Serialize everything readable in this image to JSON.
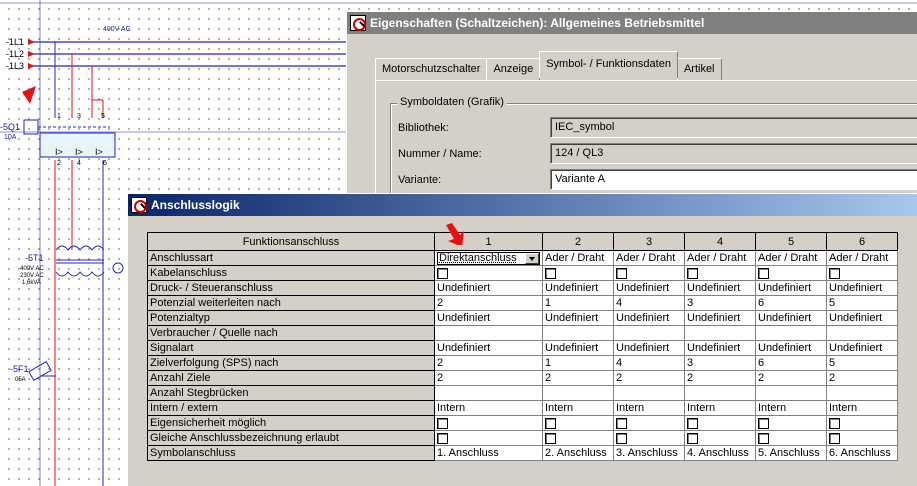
{
  "schematic": {
    "phases": [
      "-1L1",
      "-1L2",
      "-1L3"
    ],
    "voltage_label": "400V AC",
    "breaker_tag": "-5Q1",
    "breaker_rating": "10A",
    "transformer_tag": "-5T1",
    "transformer_specs": [
      "400V AC",
      "230V AC",
      "1,6kVA"
    ],
    "fuse_tag": "-5F1",
    "fuse_rating": "05A",
    "terminal_numbers": [
      "1",
      "3",
      "5",
      "2",
      "4",
      "6"
    ],
    "trip_symbol": "I>",
    "annotation_color": "#e81010"
  },
  "properties_dialog": {
    "title": "Eigenschaften (Schaltzeichen): Allgemeines Betriebsmittel",
    "tabs": [
      "Motorschutzschalter",
      "Anzeige",
      "Symbol- / Funktionsdaten",
      "Artikel"
    ],
    "selected_tab": "Symbol- / Funktionsdaten",
    "group_title": "Symboldaten (Grafik)",
    "fields": {
      "library_label": "Bibliothek:",
      "library_value": "IEC_symbol",
      "number_label": "Nummer / Name:",
      "number_value": "124 / QL3",
      "variant_label": "Variante:",
      "variant_value": "Variante A"
    }
  },
  "logic_dialog": {
    "title": "Anschlusslogik",
    "corner_header": "Funktionsanschluss",
    "columns": [
      "1",
      "2",
      "3",
      "4",
      "5",
      "6"
    ],
    "rows": [
      {
        "label": "Anschlussart",
        "type": "text",
        "values": [
          "Direktanschluss",
          "Ader / Draht",
          "Ader / Draht",
          "Ader / Draht",
          "Ader / Draht",
          "Ader / Draht"
        ]
      },
      {
        "label": "Kabelanschluss",
        "type": "checkbox",
        "values": [
          "",
          "",
          "",
          "",
          "",
          ""
        ]
      },
      {
        "label": "Druck- / Steueranschluss",
        "type": "text",
        "values": [
          "Undefiniert",
          "Undefiniert",
          "Undefiniert",
          "Undefiniert",
          "Undefiniert",
          "Undefiniert"
        ]
      },
      {
        "label": "Potenzial weiterleiten nach",
        "type": "text",
        "values": [
          "2",
          "1",
          "4",
          "3",
          "6",
          "5"
        ]
      },
      {
        "label": "Potenzialtyp",
        "type": "text",
        "values": [
          "Undefiniert",
          "Undefiniert",
          "Undefiniert",
          "Undefiniert",
          "Undefiniert",
          "Undefiniert"
        ]
      },
      {
        "label": "Verbraucher / Quelle nach",
        "type": "text",
        "values": [
          "",
          "",
          "",
          "",
          "",
          ""
        ]
      },
      {
        "label": "Signalart",
        "type": "text",
        "values": [
          "Undefiniert",
          "Undefiniert",
          "Undefiniert",
          "Undefiniert",
          "Undefiniert",
          "Undefiniert"
        ]
      },
      {
        "label": "Zielverfolgung (SPS) nach",
        "type": "text",
        "values": [
          "2",
          "1",
          "4",
          "3",
          "6",
          "5"
        ]
      },
      {
        "label": "Anzahl Ziele",
        "type": "text",
        "values": [
          "2",
          "2",
          "2",
          "2",
          "2",
          "2"
        ]
      },
      {
        "label": "Anzahl Stegbrücken",
        "type": "text",
        "values": [
          "",
          "",
          "",
          "",
          "",
          ""
        ]
      },
      {
        "label": "Intern / extern",
        "type": "text",
        "values": [
          "Intern",
          "Intern",
          "Intern",
          "Intern",
          "Intern",
          "Intern"
        ]
      },
      {
        "label": "Eigensicherheit möglich",
        "type": "checkbox",
        "values": [
          "",
          "",
          "",
          "",
          "",
          ""
        ]
      },
      {
        "label": "Gleiche Anschlussbezeichnung erlaubt",
        "type": "checkbox",
        "values": [
          "",
          "",
          "",
          "",
          "",
          ""
        ]
      },
      {
        "label": "Symbolanschluss",
        "type": "text",
        "values": [
          "1. Anschluss",
          "2. Anschluss",
          "3. Anschluss",
          "4. Anschluss",
          "5. Anschluss",
          "6. Anschluss"
        ]
      }
    ]
  }
}
